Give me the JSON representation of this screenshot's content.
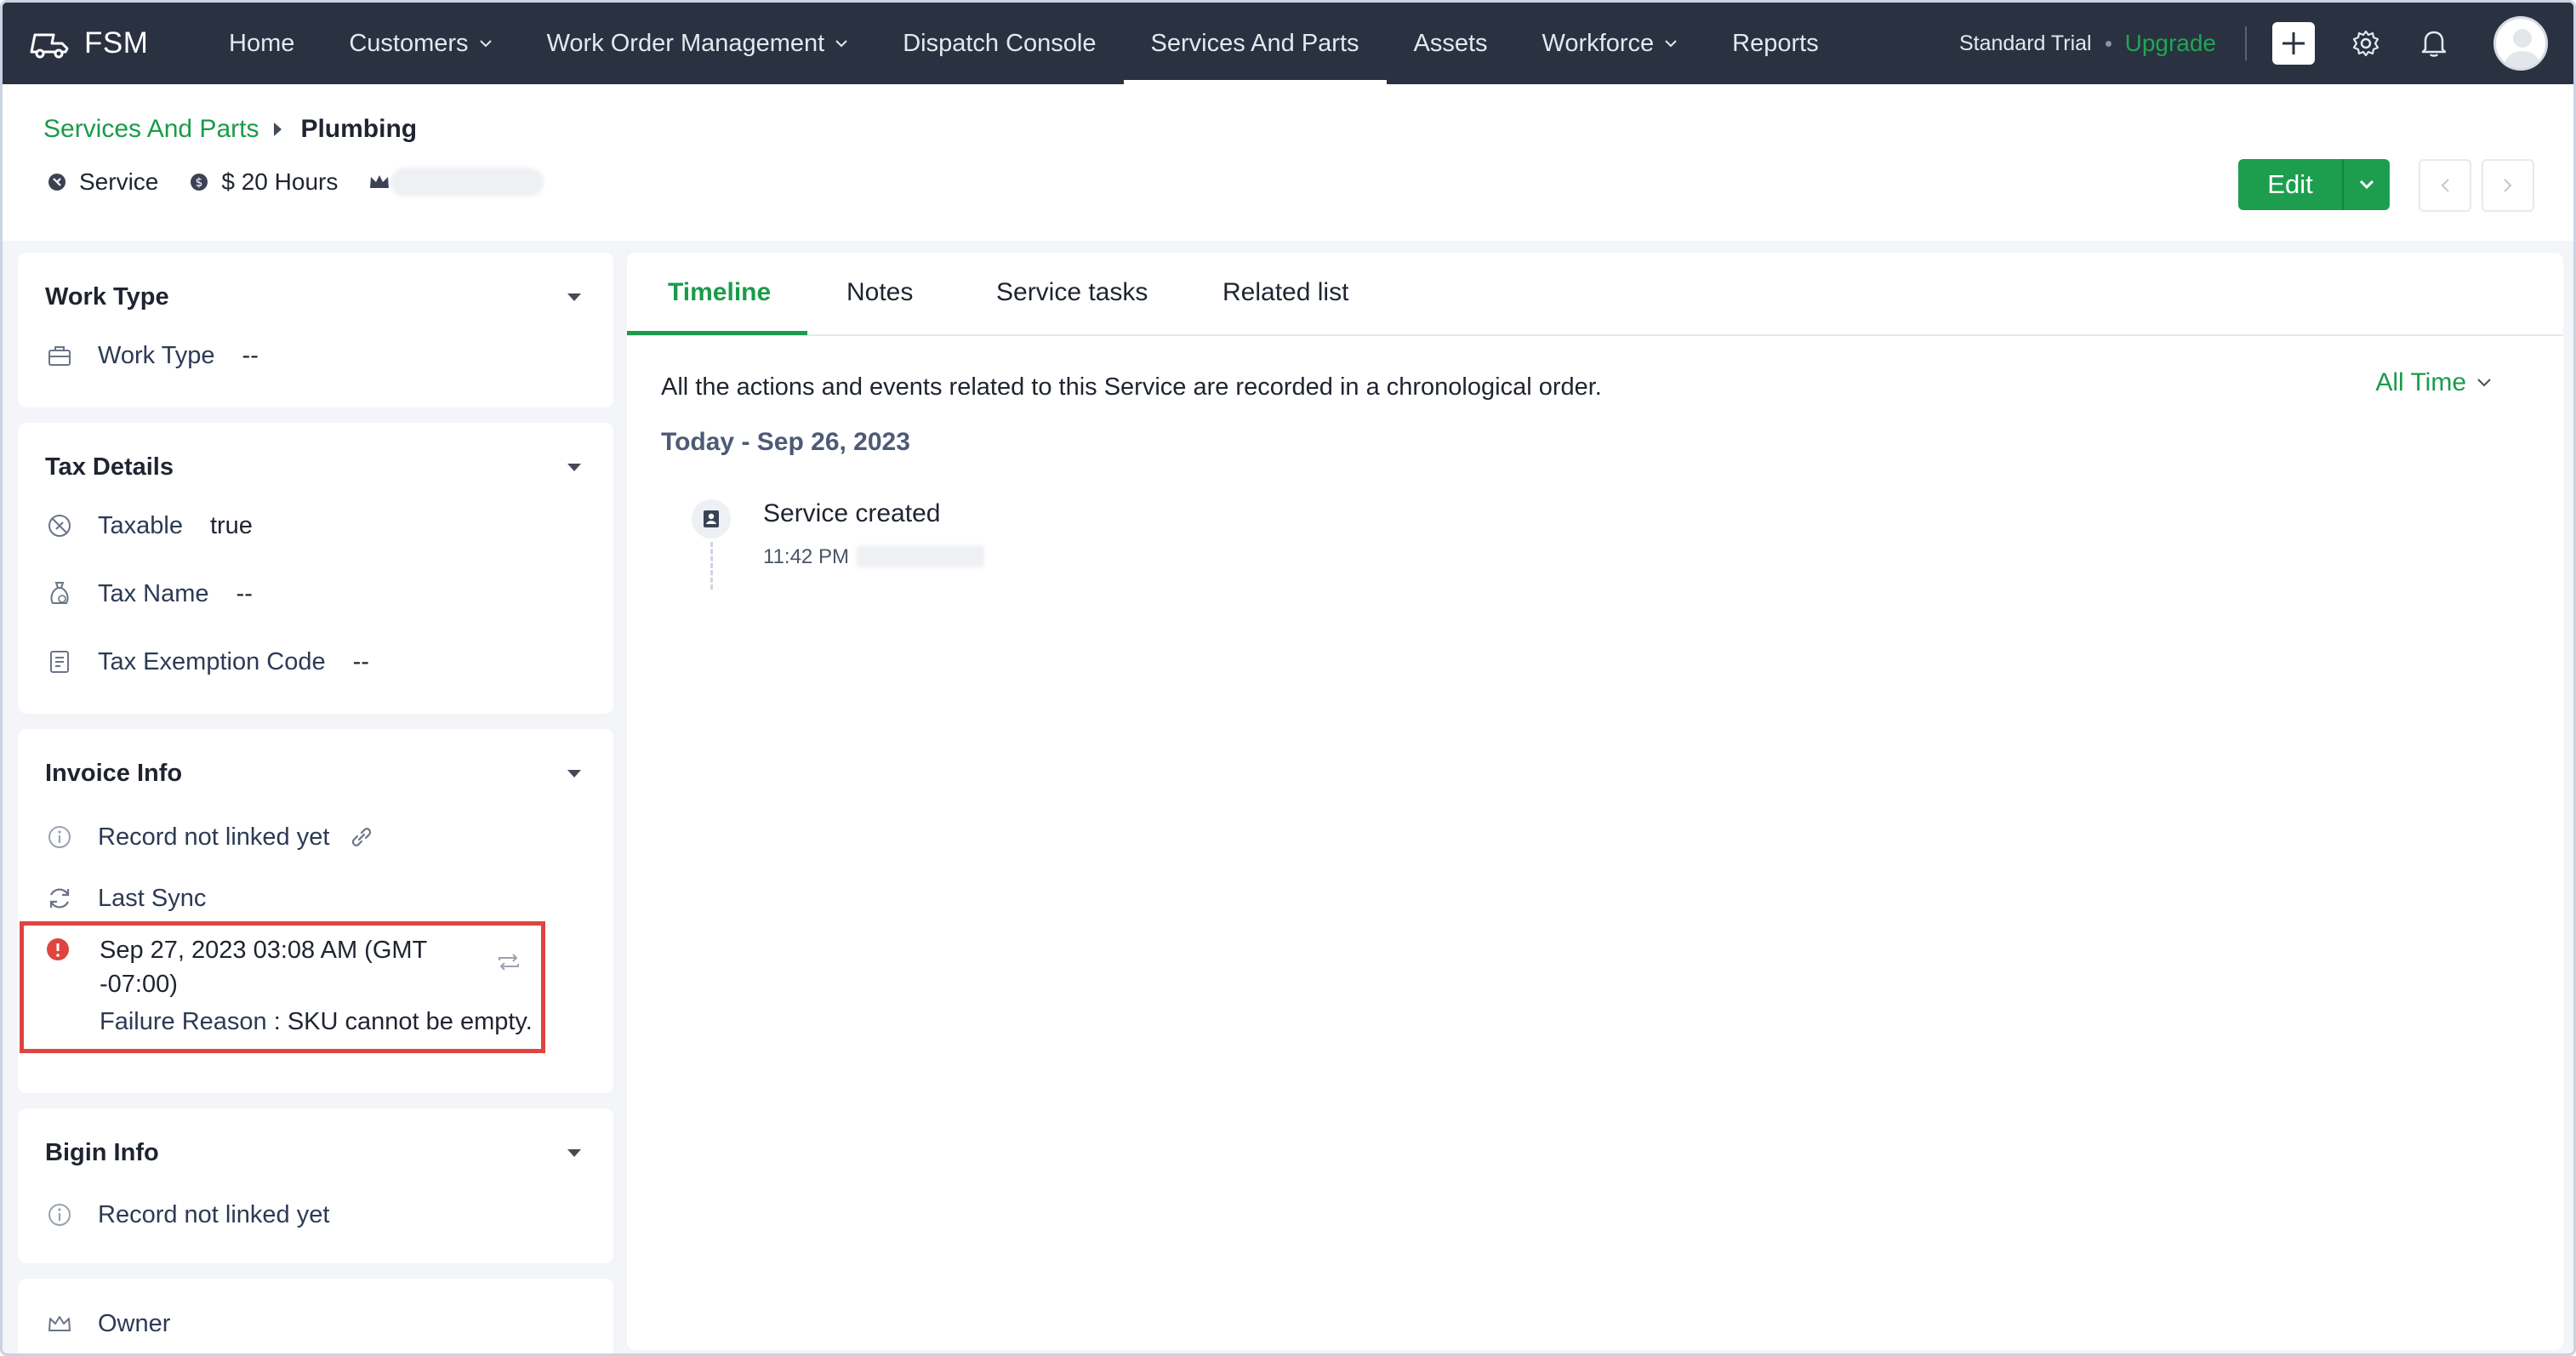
{
  "app": {
    "brand": "FSM"
  },
  "nav": {
    "items": [
      {
        "label": "Home",
        "has_dropdown": false
      },
      {
        "label": "Customers",
        "has_dropdown": true
      },
      {
        "label": "Work Order Management",
        "has_dropdown": true
      },
      {
        "label": "Dispatch Console",
        "has_dropdown": false
      },
      {
        "label": "Services And Parts",
        "has_dropdown": false,
        "active": true
      },
      {
        "label": "Assets",
        "has_dropdown": false
      },
      {
        "label": "Workforce",
        "has_dropdown": true
      },
      {
        "label": "Reports",
        "has_dropdown": false
      }
    ],
    "plan": "Standard Trial",
    "upgrade": "Upgrade"
  },
  "breadcrumb": {
    "parent": "Services And Parts",
    "current": "Plumbing"
  },
  "meta": {
    "type": "Service",
    "price": "$ 20 Hours"
  },
  "actions": {
    "edit": "Edit"
  },
  "cards": {
    "work_type": {
      "title": "Work Type",
      "field_label": "Work Type",
      "field_value": "--"
    },
    "tax_details": {
      "title": "Tax Details",
      "taxable_label": "Taxable",
      "taxable_value": "true",
      "tax_name_label": "Tax Name",
      "tax_name_value": "--",
      "exemption_label": "Tax Exemption Code",
      "exemption_value": "--"
    },
    "invoice_info": {
      "title": "Invoice Info",
      "not_linked": "Record not linked yet",
      "last_sync": "Last Sync",
      "sync_time_line1": "Sep 27, 2023 03:08 AM (GMT",
      "sync_time_line2": "-07:00)",
      "failure_label": "Failure Reason",
      "failure_sep": " : ",
      "failure_value": "SKU cannot be empty."
    },
    "bigin_info": {
      "title": "Bigin Info",
      "not_linked": "Record not linked yet"
    },
    "owner": {
      "label": "Owner"
    }
  },
  "tabs": [
    "Timeline",
    "Notes",
    "Service tasks",
    "Related list"
  ],
  "timeline": {
    "description": "All the actions and events related to this Service are recorded in a chronological order.",
    "filter": "All Time",
    "date_heading": "Today - Sep 26, 2023",
    "events": [
      {
        "title": "Service created",
        "time": "11:42 PM"
      }
    ]
  },
  "colors": {
    "accent": "#1a9b4b",
    "nav_bg": "#2a3140",
    "error": "#e0443f"
  }
}
